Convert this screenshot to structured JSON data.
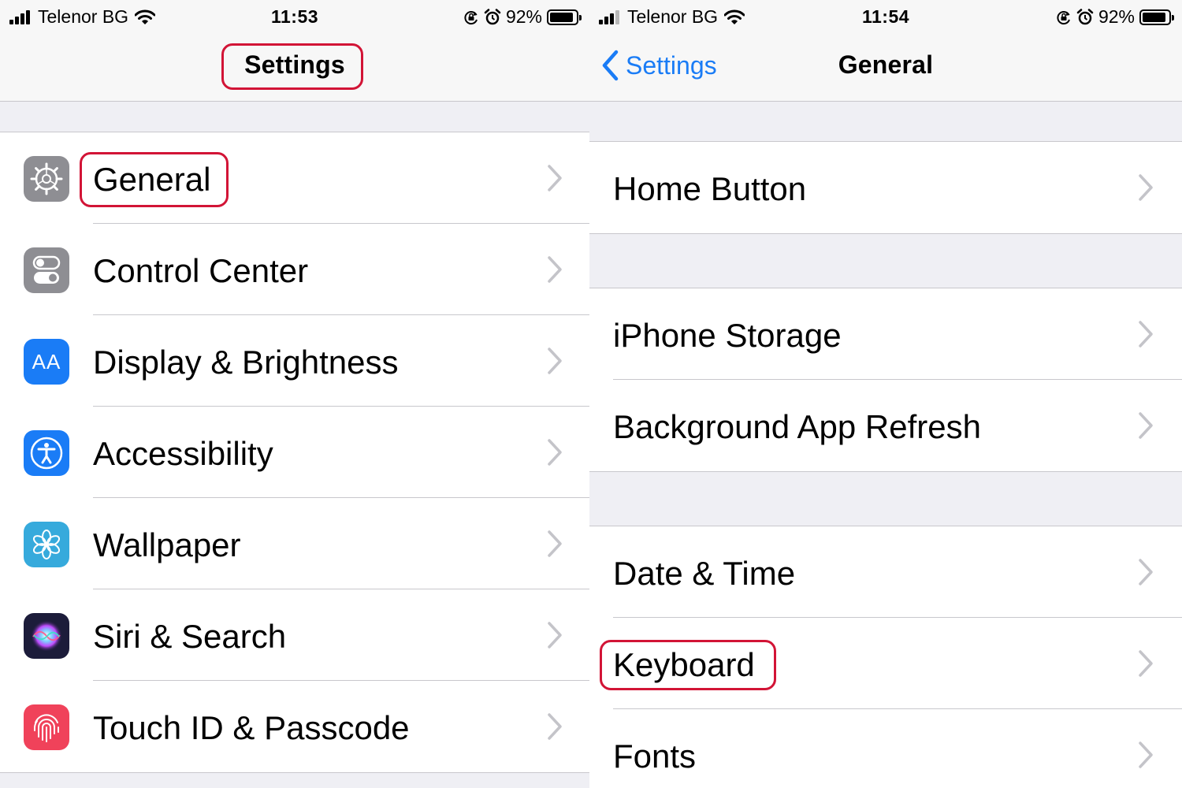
{
  "left_screen": {
    "status": {
      "carrier": "Telenor BG",
      "time": "11:53",
      "battery": "92%",
      "battery_level": 0.92
    },
    "nav": {
      "title": "Settings"
    },
    "rows": [
      {
        "label": "General",
        "icon": "gear-icon",
        "color": "#8e8e93"
      },
      {
        "label": "Control Center",
        "icon": "toggles-icon",
        "color": "#8e8e93"
      },
      {
        "label": "Display & Brightness",
        "icon": "text-size-icon",
        "icon_text": "AA",
        "color": "#1a7cf6"
      },
      {
        "label": "Accessibility",
        "icon": "accessibility-icon",
        "color": "#1a7cf6"
      },
      {
        "label": "Wallpaper",
        "icon": "flower-icon",
        "color": "#36aadc"
      },
      {
        "label": "Siri & Search",
        "icon": "siri-icon",
        "color": "#1c1c3a"
      },
      {
        "label": "Touch ID & Passcode",
        "icon": "fingerprint-icon",
        "color": "#f0425a"
      }
    ]
  },
  "right_screen": {
    "status": {
      "carrier": "Telenor BG",
      "time": "11:54",
      "battery": "92%",
      "battery_level": 0.92
    },
    "nav": {
      "back_label": "Settings",
      "title": "General"
    },
    "groups": [
      {
        "rows": [
          {
            "label": "Home Button"
          }
        ]
      },
      {
        "rows": [
          {
            "label": "iPhone Storage"
          },
          {
            "label": "Background App Refresh"
          }
        ]
      },
      {
        "rows": [
          {
            "label": "Date & Time"
          },
          {
            "label": "Keyboard"
          },
          {
            "label": "Fonts"
          }
        ]
      }
    ]
  },
  "theme": {
    "accent": "#1a7cf6",
    "highlight": "#d21436",
    "separator": "#c8c7cc",
    "grouped_background": "#efeff4"
  }
}
